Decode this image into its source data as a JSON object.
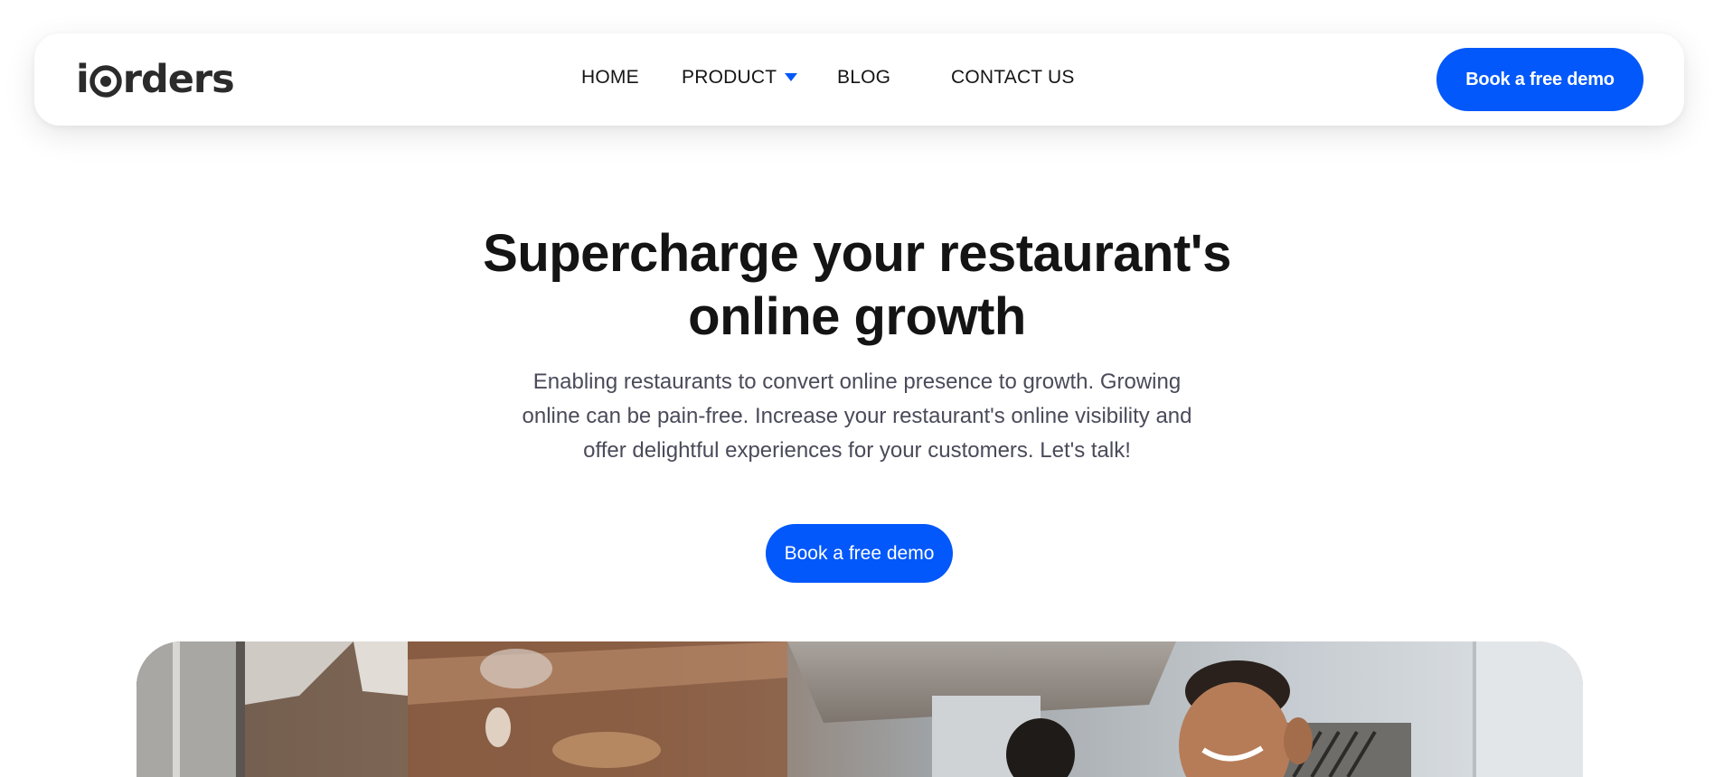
{
  "brand": {
    "name": "iOrders",
    "logo_prefix": "i",
    "logo_suffix": "rders",
    "accent_color": "#0258fa"
  },
  "nav": {
    "items": [
      {
        "label": "HOME"
      },
      {
        "label": "PRODUCT",
        "has_dropdown": true,
        "icon": "caret-down-icon"
      },
      {
        "label": "BLOG"
      },
      {
        "label": "CONTACT US"
      }
    ],
    "cta_label": "Book a free demo"
  },
  "hero": {
    "title_line1": "Supercharge your restaurant's",
    "title_line2": "online growth",
    "subtitle_line1": "Enabling restaurants to convert online presence to growth. Growing",
    "subtitle_line2": "online can be pain-free. Increase your restaurant's online visibility and",
    "subtitle_line3": "offer delightful experiences for your customers. Let's talk!",
    "cta_label": "Book a free demo",
    "image": "restaurant-kitchen-chefs-photo"
  }
}
